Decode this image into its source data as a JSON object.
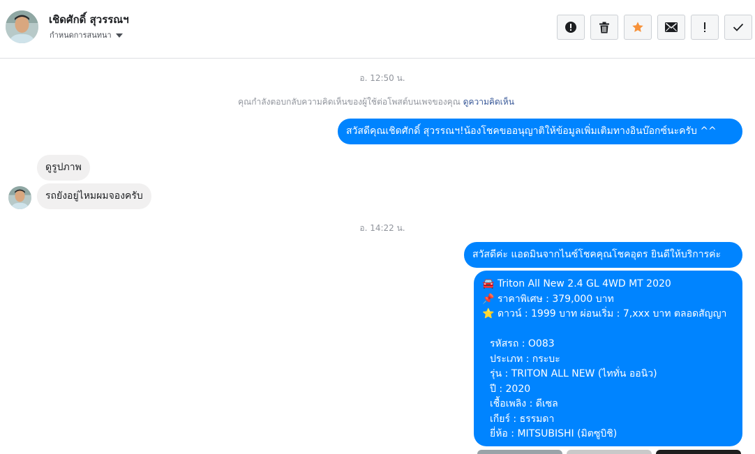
{
  "header": {
    "name": "เชิดศักดิ์ สุวรรณฯ",
    "subtitle": "กำหนดการสนทนา",
    "actions": [
      {
        "name": "report-button",
        "icon": "alert-circle-icon"
      },
      {
        "name": "delete-button",
        "icon": "trash-icon"
      },
      {
        "name": "star-button",
        "icon": "star-icon"
      },
      {
        "name": "mark-unread-button",
        "icon": "envelope-icon"
      },
      {
        "name": "spam-button",
        "icon": "exclamation-icon"
      },
      {
        "name": "mark-done-button",
        "icon": "check-icon"
      }
    ]
  },
  "conversation": {
    "timestamp_1": "อ. 12:50 น.",
    "notice_text": "คุณกำลังตอบกลับความคิดเห็นของผู้ใช้ต่อโพสต์บนเพจของคุณ",
    "notice_link": "ดูความคิดเห็น",
    "msg_out_1": "สวัสดีคุณเชิดศักดิ์ สุวรรณฯ!น้องโชคขออนุญาติให้ข้อมูลเพิ่มเติมทางอินบ๊อกซ์นะครับ ^^",
    "msg_in_1": "ดูรูปภาพ",
    "msg_in_2": "รถยังอยู่ไหมผมจองครับ",
    "timestamp_2": "อ. 14:22 น.",
    "msg_out_2": "สวัสดีค่ะ แอดมินจากไนซ์โชคคุณโชคอุดร ยินดีให้บริการค่ะ",
    "card": {
      "line1_emoji": "🚘",
      "line1": "Triton All New 2.4 GL 4WD MT 2020",
      "line2_emoji": "📌",
      "line2": "ราคาพิเศษ : 379,000 บาท",
      "line3_emoji": "⭐",
      "line3": "ดาวน์ : 1999 บาท ผ่อนเริ่ม : 7,xxx บาท ตลอดสัญญา",
      "code": "รหัสรถ : O083",
      "type": "ประเภท : กระบะ",
      "model": "รุ่น : TRITON ALL NEW (ไททั่น ออนิว)",
      "year": "ปี : 2020",
      "fuel": "เชื้อเพลิง : ดีเซล",
      "gear": "เกียร์ : ธรรมดา",
      "brand": "ยี่ห้อ : MITSUBISHI (มิตซูบิชิ)"
    }
  },
  "colors": {
    "outgoing_bubble": "#0084ff",
    "incoming_bubble": "#f1f0f0",
    "star": "#f7923a",
    "link": "#385898"
  }
}
